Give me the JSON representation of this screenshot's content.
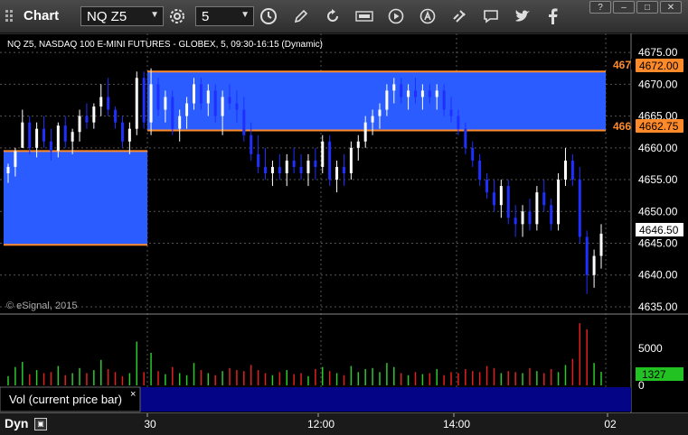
{
  "toolbar": {
    "title": "Chart",
    "symbol": "NQ Z5",
    "interval": "5",
    "buttons": [
      {
        "name": "settings-icon"
      },
      {
        "name": "clock-icon"
      },
      {
        "name": "draw-pencil-icon"
      },
      {
        "name": "refresh-icon"
      },
      {
        "name": "get-icon"
      },
      {
        "name": "play-icon"
      },
      {
        "name": "alert-icon"
      },
      {
        "name": "link-icon"
      },
      {
        "name": "chat-icon"
      },
      {
        "name": "twitter-icon"
      },
      {
        "name": "facebook-icon"
      }
    ],
    "window_buttons": [
      "?",
      "–",
      "□",
      "✕"
    ]
  },
  "chart": {
    "header": "NQ Z5, NASDAQ 100 E-MINI FUTURES - GLOBEX, 5, 09:30-16:15 (Dynamic)",
    "watermark": "© eSignal, 2015",
    "price_ticks": [
      "4675.00",
      "4670.00",
      "4665.00",
      "4660.00",
      "4655.00",
      "4650.00",
      "4645.00",
      "4640.00",
      "4635.00"
    ],
    "upper_level_label": "4672.00",
    "upper_level_cut": "467",
    "lower_level_label": "4662.75",
    "lower_level_cut": "466",
    "current_price": "4646.50",
    "volume_ticks": [
      "5000",
      "0"
    ],
    "current_volume": "1327",
    "volume_panel_label": "Vol (current price bar)",
    "volume_close": "×",
    "time_labels": [
      "30",
      "12:00",
      "14:00",
      "02"
    ],
    "dyn_label": "Dyn",
    "colors": {
      "zone": "#2a5cff",
      "level_line": "#ff8a2a",
      "up_candle": "#ffffff",
      "down_candle": "#1f2fff",
      "vol_up": "#2cc82c",
      "vol_down": "#e02020",
      "vol_badge": "#23c223"
    }
  },
  "chart_data": {
    "type": "candlestick",
    "y_unit": "price",
    "ylim": [
      4634,
      4678
    ],
    "candles": [
      [
        4656,
        4657.5,
        4654.5,
        4657
      ],
      [
        4657,
        4660,
        4655.5,
        4659.5
      ],
      [
        4660,
        4666,
        4660,
        4664
      ],
      [
        4664,
        4665,
        4659,
        4660
      ],
      [
        4660,
        4664,
        4658.5,
        4663
      ],
      [
        4663,
        4665,
        4660,
        4661
      ],
      [
        4661,
        4663,
        4658,
        4659.5
      ],
      [
        4659.5,
        4664,
        4658.5,
        4663.5
      ],
      [
        4663.5,
        4665,
        4660,
        4661
      ],
      [
        4661,
        4663,
        4659,
        4662.5
      ],
      [
        4662.5,
        4666,
        4661,
        4665
      ],
      [
        4665,
        4667,
        4663,
        4664
      ],
      [
        4664,
        4667,
        4663,
        4666.5
      ],
      [
        4666.5,
        4670,
        4665,
        4668
      ],
      [
        4668,
        4671,
        4665,
        4666
      ],
      [
        4666,
        4666.5,
        4663,
        4664
      ],
      [
        4664,
        4665,
        4660,
        4661
      ],
      [
        4661,
        4664,
        4659,
        4663
      ],
      [
        4663,
        4672,
        4662,
        4671
      ],
      [
        4671,
        4672,
        4663,
        4664
      ],
      [
        4664,
        4672.5,
        4662,
        4670
      ],
      [
        4670,
        4671,
        4665,
        4666
      ],
      [
        4666,
        4669,
        4664,
        4668
      ],
      [
        4668,
        4669,
        4662,
        4663
      ],
      [
        4663,
        4666,
        4661,
        4665
      ],
      [
        4665,
        4668,
        4663,
        4667
      ],
      [
        4667,
        4671,
        4666,
        4670
      ],
      [
        4670,
        4671,
        4666,
        4667
      ],
      [
        4667,
        4670,
        4665,
        4669
      ],
      [
        4669,
        4670,
        4664,
        4665
      ],
      [
        4665,
        4669,
        4662,
        4668
      ],
      [
        4668,
        4670,
        4666,
        4667
      ],
      [
        4667,
        4669,
        4664,
        4666
      ],
      [
        4666,
        4668,
        4661,
        4662
      ],
      [
        4662,
        4664,
        4658,
        4659
      ],
      [
        4659,
        4662,
        4656,
        4657
      ],
      [
        4657,
        4660,
        4655,
        4656
      ],
      [
        4656,
        4658,
        4654,
        4657
      ],
      [
        4657,
        4659,
        4655,
        4656
      ],
      [
        4656,
        4659,
        4654,
        4658
      ],
      [
        4658,
        4660,
        4656,
        4657
      ],
      [
        4657,
        4659,
        4655,
        4656
      ],
      [
        4656,
        4659,
        4654,
        4658
      ],
      [
        4658,
        4660,
        4655,
        4657
      ],
      [
        4657,
        4662,
        4656,
        4661
      ],
      [
        4661,
        4662,
        4654,
        4655
      ],
      [
        4655,
        4658,
        4653,
        4657
      ],
      [
        4657,
        4659,
        4654,
        4656
      ],
      [
        4656,
        4661,
        4655,
        4660
      ],
      [
        4660,
        4662,
        4658,
        4661
      ],
      [
        4661,
        4665,
        4660,
        4664
      ],
      [
        4664,
        4666,
        4662,
        4665
      ],
      [
        4665,
        4667,
        4663,
        4666
      ],
      [
        4666,
        4670,
        4665,
        4669
      ],
      [
        4669,
        4671,
        4667,
        4670
      ],
      [
        4670,
        4671,
        4667,
        4668
      ],
      [
        4668,
        4670,
        4666,
        4669
      ],
      [
        4669,
        4671,
        4667,
        4668
      ],
      [
        4668,
        4670,
        4666,
        4669
      ],
      [
        4669,
        4670,
        4667,
        4668
      ],
      [
        4668,
        4670,
        4666,
        4669
      ],
      [
        4669,
        4670,
        4665,
        4666
      ],
      [
        4666,
        4668,
        4664,
        4665
      ],
      [
        4665,
        4666,
        4662,
        4663
      ],
      [
        4663,
        4664,
        4659,
        4660
      ],
      [
        4660,
        4661,
        4657,
        4658
      ],
      [
        4658,
        4659,
        4654,
        4655
      ],
      [
        4655,
        4656,
        4652,
        4653
      ],
      [
        4653,
        4655,
        4650,
        4651
      ],
      [
        4651,
        4655,
        4649,
        4654
      ],
      [
        4654,
        4655,
        4648,
        4649
      ],
      [
        4649,
        4651,
        4646,
        4648
      ],
      [
        4648,
        4651,
        4646,
        4650
      ],
      [
        4650,
        4652,
        4647,
        4648
      ],
      [
        4648,
        4654,
        4647,
        4653
      ],
      [
        4653,
        4655,
        4650,
        4651
      ],
      [
        4651,
        4652,
        4647,
        4648
      ],
      [
        4648,
        4656,
        4647,
        4655
      ],
      [
        4655,
        4660,
        4654,
        4658
      ],
      [
        4658,
        4659,
        4654,
        4655
      ],
      [
        4655,
        4657,
        4645,
        4646
      ],
      [
        4646,
        4647,
        4637,
        4640
      ],
      [
        4640,
        4644,
        4638,
        4643
      ],
      [
        4643,
        4648,
        4641,
        4646.5
      ]
    ],
    "volume_ylim": [
      0,
      7000
    ],
    "volume": [
      900,
      1800,
      2300,
      1100,
      1500,
      1200,
      1300,
      1900,
      1000,
      1200,
      1700,
      1200,
      1500,
      2500,
      1600,
      1300,
      900,
      1200,
      4300,
      1300,
      3200,
      1400,
      1100,
      1800,
      1200,
      1000,
      2200,
      1500,
      1200,
      1000,
      1400,
      1700,
      1500,
      1400,
      2000,
      1500,
      1200,
      1000,
      1300,
      1500,
      1100,
      1200,
      900,
      1600,
      1800,
      1400,
      1200,
      1000,
      1900,
      1300,
      1600,
      1700,
      1300,
      2200,
      1800,
      1200,
      1000,
      1300,
      1100,
      1200,
      1600,
      1000,
      1300,
      1200,
      1600,
      1400,
      1300,
      1900,
      1700,
      1200,
      1400,
      1300,
      1200,
      1700,
      1400,
      1200,
      1600,
      1300,
      2000,
      2600,
      6100,
      5500,
      2200,
      1327
    ]
  }
}
